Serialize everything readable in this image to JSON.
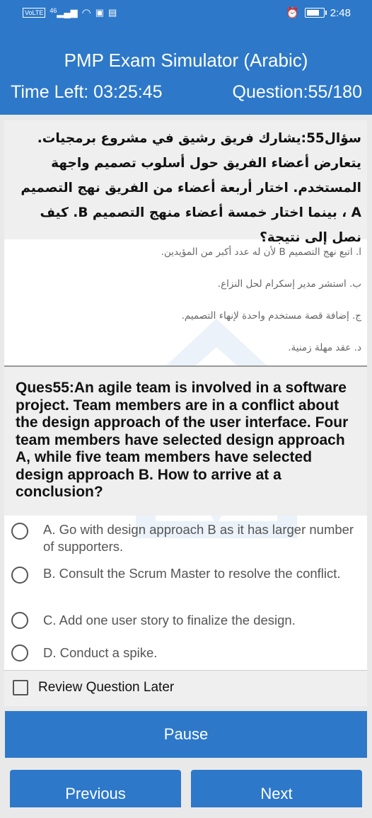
{
  "status_bar": {
    "network": "VoLTE",
    "signal": "46",
    "time": "2:48"
  },
  "app": {
    "title": "PMP Exam Simulator (Arabic)",
    "time_left": "Time Left: 03:25:45",
    "question_counter": "Question:55/180"
  },
  "arabic": {
    "question": "سؤال55:يشارك فريق رشيق في مشروع برمجيات. يتعارض أعضاء الفريق حول أسلوب تصميم واجهة المستخدم. اختار أربعة أعضاء من الفريق نهج التصميم A ، بينما اختار خمسة أعضاء منهج التصميم B. كيف نصل إلى نتيجة؟",
    "options": [
      "ا. اتبع نهج التصميم B لأن له عدد أكبر من المؤيدين.",
      "ب. استشر مدير إسكرام لحل النزاع.",
      "ج. إضافة قصة مستخدم واحدة لإنهاء التصميم.",
      "د. عقد مهلة زمنية."
    ]
  },
  "english": {
    "question": "Ques55:An agile team is involved in a software project. Team members are in a conflict about the design approach of the user interface. Four team members have selected design approach A, while five team members have selected design approach B. How to arrive at a conclusion?",
    "options": [
      "A. Go with design approach B as it has larger number of supporters.",
      "B. Consult the Scrum Master to resolve the conflict.",
      "C. Add one user story to finalize the design.",
      "D. Conduct a spike."
    ]
  },
  "review_label": "Review Question Later",
  "buttons": {
    "pause": "Pause",
    "previous": "Previous",
    "next": "Next"
  },
  "colors": {
    "accent": "#2d78c9",
    "question_bg": "#efefef"
  },
  "battery_level": 0.85
}
